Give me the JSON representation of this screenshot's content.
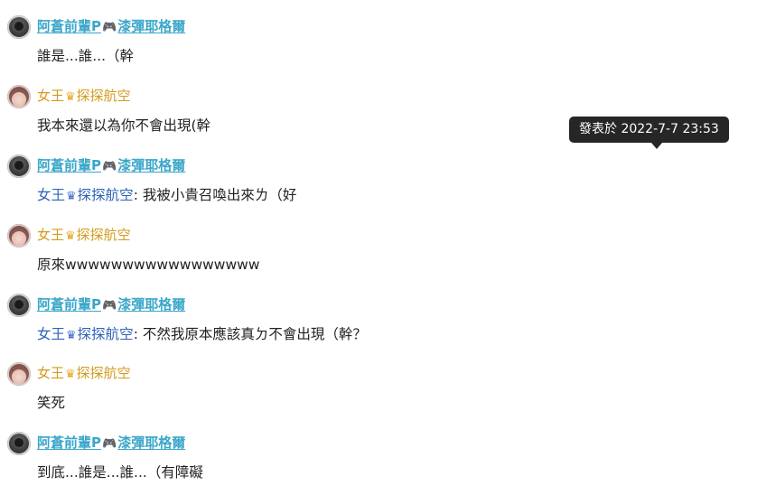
{
  "comments": [
    {
      "user": "阿蒼前輩P",
      "user_suffix": "漆彈耶格爾",
      "badge": "gamepad",
      "text": "誰是...誰...（幹"
    },
    {
      "user": "女王",
      "user_suffix": "探探航空",
      "badge": "crown",
      "text": "我本來還以為你不會出現(幹"
    },
    {
      "user": "阿蒼前輩P",
      "user_suffix": "漆彈耶格爾",
      "badge": "gamepad",
      "reply_to": "女王",
      "reply_to_suffix": "探探航空",
      "text": ": 我被小貴召喚出來ㄌ（好"
    },
    {
      "user": "女王",
      "user_suffix": "探探航空",
      "badge": "crown",
      "text": "原來wwwwwwwwwwwwwwwww"
    },
    {
      "user": "阿蒼前輩P",
      "user_suffix": "漆彈耶格爾",
      "badge": "gamepad",
      "reply_to": "女王",
      "reply_to_suffix": "探探航空",
      "text": ": 不然我原本應該真ㄉ不會出現（幹？"
    },
    {
      "user": "女王",
      "user_suffix": "探探航空",
      "badge": "crown",
      "text": "笑死"
    },
    {
      "user": "阿蒼前輩P",
      "user_suffix": "漆彈耶格爾",
      "badge": "gamepad",
      "text": "到底...誰是...誰...（有障礙"
    }
  ],
  "tooltip": {
    "text": "發表於 2022-7-7 23:53"
  },
  "icons": {
    "gamepad": "🎮",
    "crown": "♛",
    "queen": "♛"
  },
  "colors": {
    "blue_user": "#3aa6c9",
    "gold_user": "#d39b1c",
    "reply_name": "#2e63b8",
    "tooltip_bg": "#262626"
  }
}
